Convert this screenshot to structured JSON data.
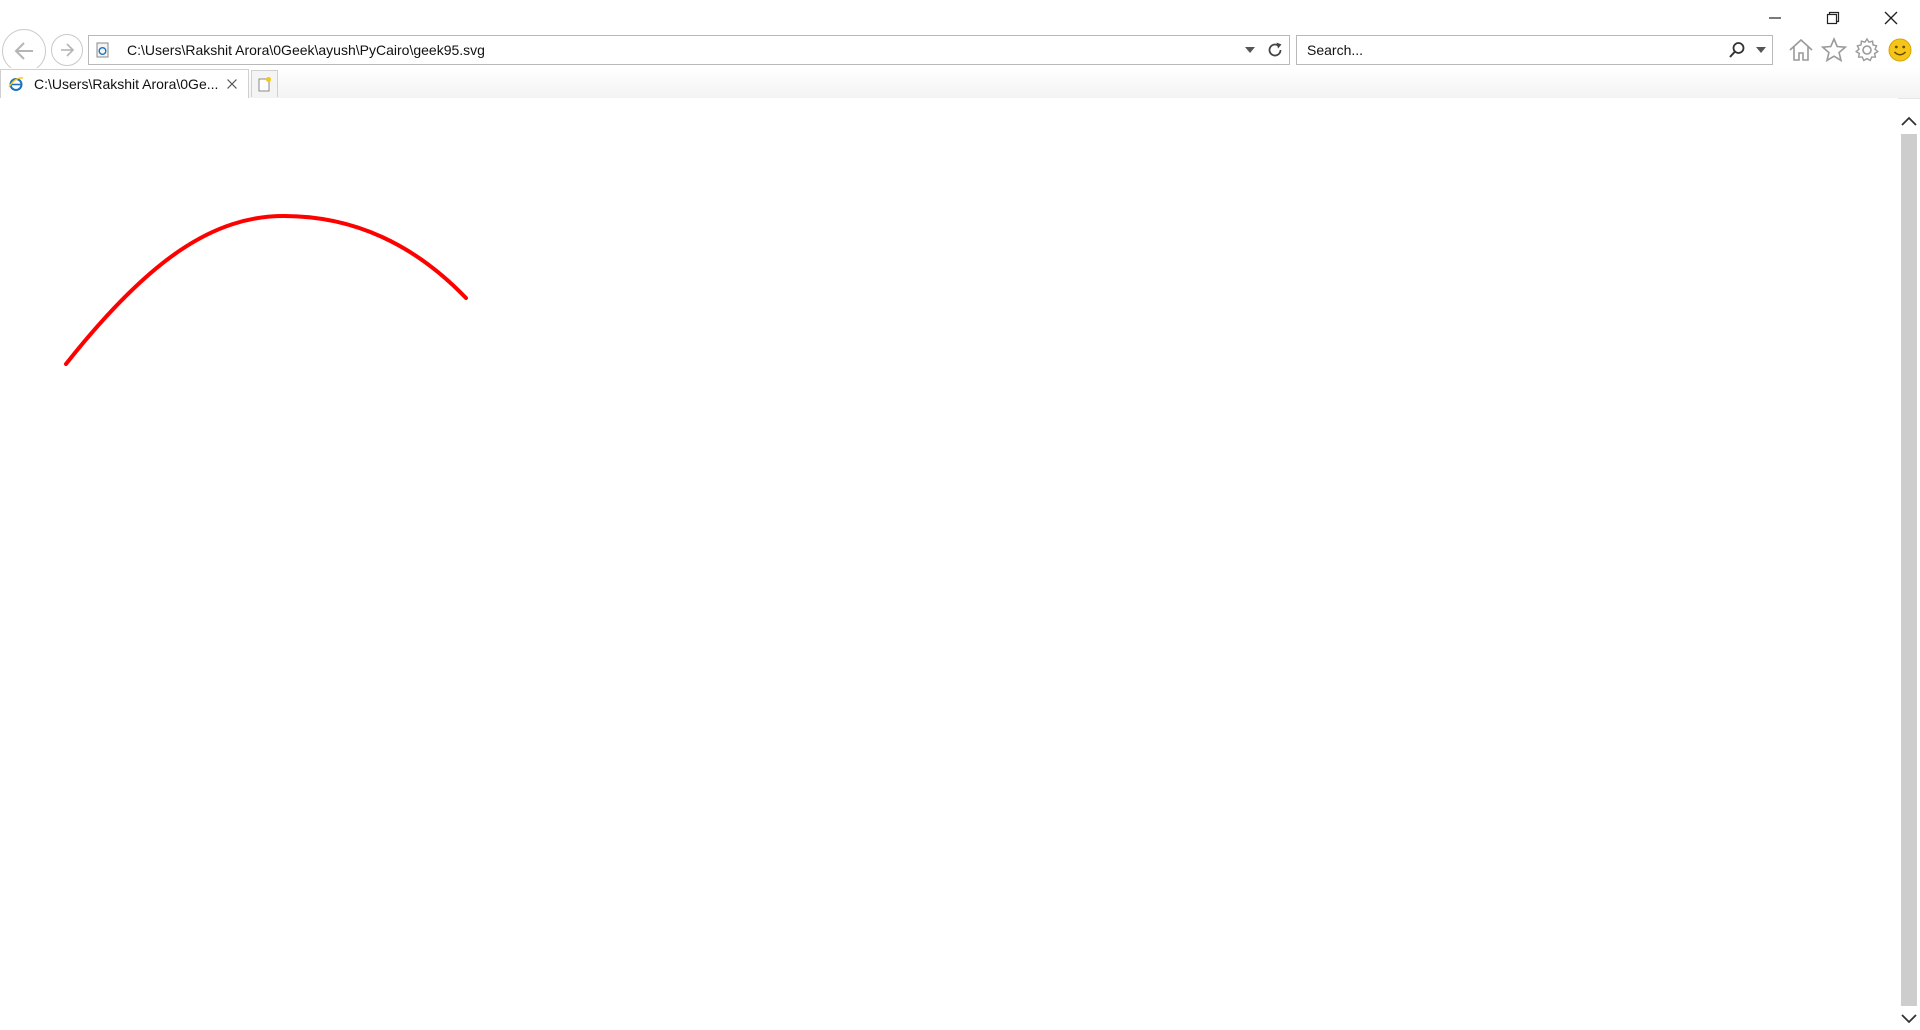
{
  "window": {
    "minimize_icon": "minimize-icon",
    "restore_icon": "restore-icon",
    "close_icon": "close-icon"
  },
  "navigation": {
    "back_icon": "back-arrow-icon",
    "forward_icon": "forward-arrow-icon"
  },
  "address_bar": {
    "url": "C:\\Users\\Rakshit Arora\\0Geek\\ayush\\PyCairo\\geek95.svg"
  },
  "search": {
    "placeholder": "Search..."
  },
  "toolbar": {
    "icons": [
      "home-icon",
      "favorites-star-icon",
      "settings-gear-icon",
      "feedback-smiley-icon"
    ]
  },
  "tabs": [
    {
      "title": "C:\\Users\\Rakshit Arora\\0Ge...",
      "active": true
    }
  ],
  "content": {
    "curve_color": "#ff0000"
  },
  "colors": {
    "accent_blue": "#1e73be",
    "smiley_yellow": "#f5c518",
    "icon_gray": "#9a9a9a"
  }
}
